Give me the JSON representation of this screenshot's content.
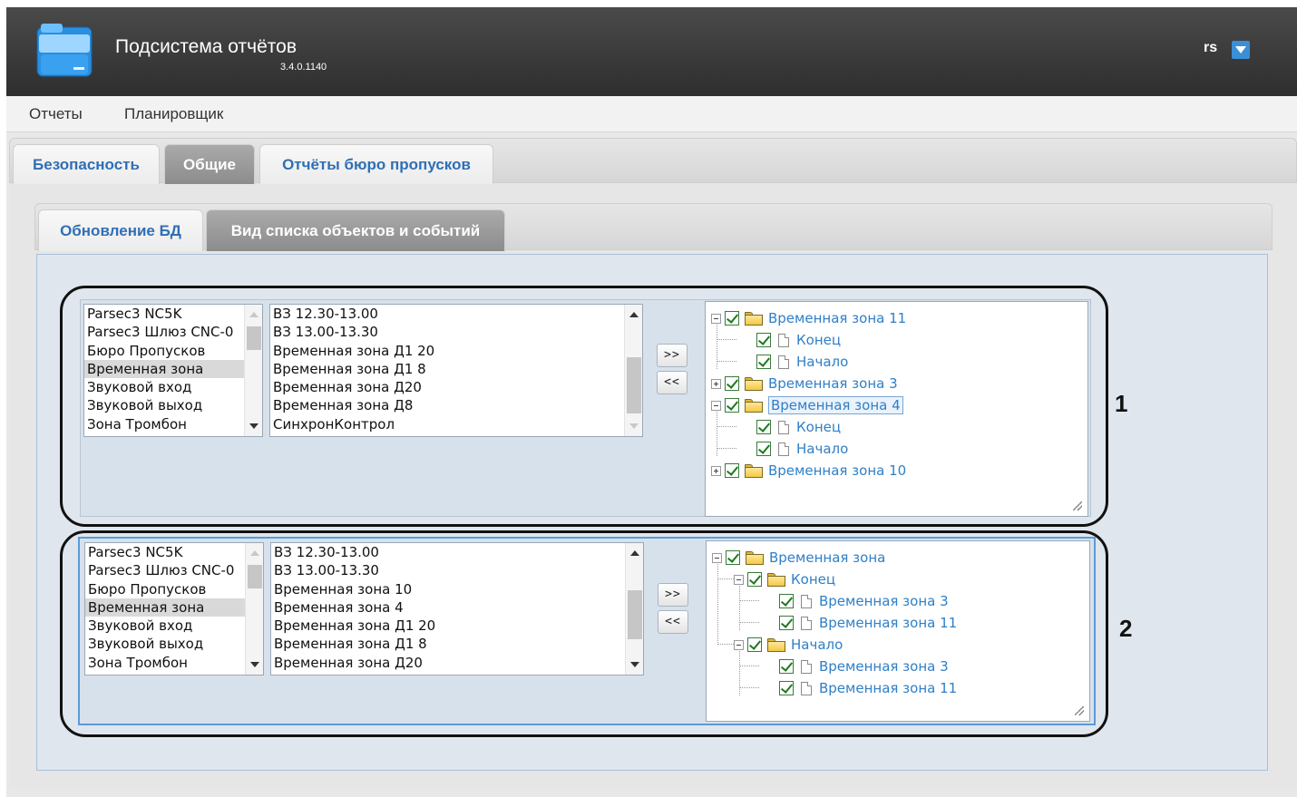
{
  "header": {
    "title": "Подсистема отчётов",
    "version": "3.4.0.1140",
    "user": "rs"
  },
  "menu": [
    "Отчеты",
    "Планировщик"
  ],
  "tabs": [
    "Безопасность",
    "Общие",
    "Отчёты бюро пропусков"
  ],
  "active_tab": "Общие",
  "subtabs": [
    "Обновление БД",
    "Вид списка объектов и событий"
  ],
  "active_subtab": "Вид списка объектов и событий",
  "panel1": {
    "objects": [
      "Parsec3 NC5K",
      "Parsec3 Шлюз CNC-0",
      "Бюро Пропусков",
      "Временная зона",
      "Звуковой вход",
      "Звуковой выход",
      "Зона Тромбон"
    ],
    "selected_object": "Временная зона",
    "items": [
      "ВЗ 12.30-13.00",
      "ВЗ 13.00-13.30",
      "Временная зона Д1 20",
      "Временная зона Д1 8",
      "Временная зона Д20",
      "Временная зона Д8",
      "СинхронКонтрол"
    ],
    "add_label": ">>",
    "remove_label": "<<",
    "tree": {
      "n1": "Временная зона 11",
      "n1a": "Конец",
      "n1b": "Начало",
      "n2": "Временная зона 3",
      "n3": "Временная зона 4",
      "n3a": "Конец",
      "n3b": "Начало",
      "n4": "Временная зона 10"
    }
  },
  "panel2": {
    "objects": [
      "Parsec3 NC5K",
      "Parsec3 Шлюз CNC-0",
      "Бюро Пропусков",
      "Временная зона",
      "Звуковой вход",
      "Звуковой выход",
      "Зона Тромбон"
    ],
    "selected_object": "Временная зона",
    "items": [
      "ВЗ 12.30-13.00",
      "ВЗ 13.00-13.30",
      "Временная зона 10",
      "Временная зона 4",
      "Временная зона Д1 20",
      "Временная зона Д1 8",
      "Временная зона Д20"
    ],
    "add_label": ">>",
    "remove_label": "<<",
    "tree": {
      "root": "Временная зона",
      "g1": "Конец",
      "g1a": "Временная зона 3",
      "g1b": "Временная зона 11",
      "g2": "Начало",
      "g2a": "Временная зона 3",
      "g2b": "Временная зона 11"
    }
  },
  "callouts": [
    "1",
    "2"
  ],
  "colors": {
    "header_bg": "#3a3a3a",
    "tab_text": "#2f6fb5",
    "tree_link": "#2f7fc7",
    "selection_border": "#5a9bd8"
  }
}
